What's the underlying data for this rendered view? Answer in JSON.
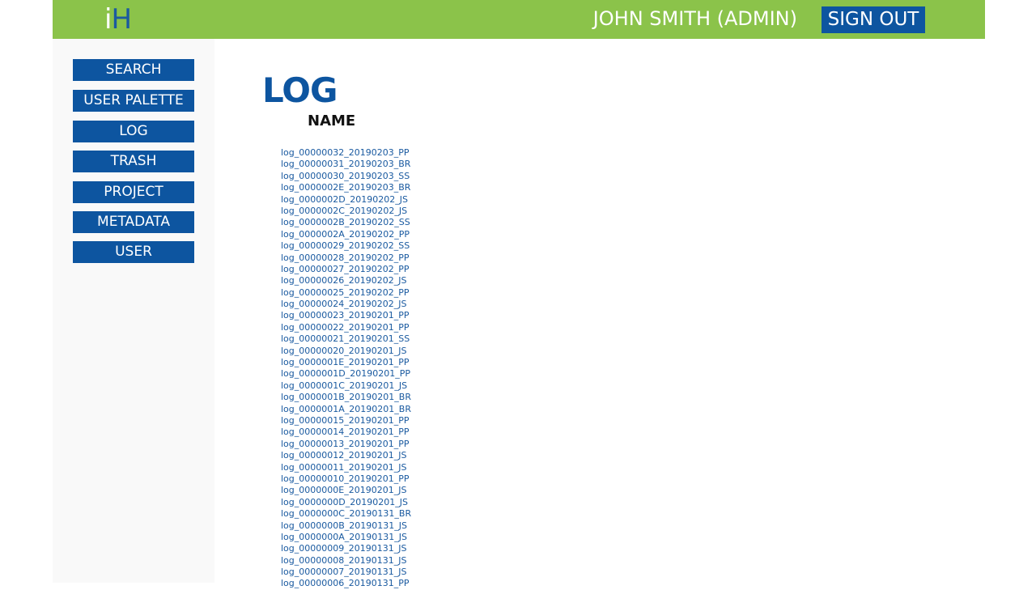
{
  "header": {
    "logo_part1": "i",
    "logo_part2": "H",
    "user_label": "JOHN SMITH (ADMIN)",
    "signout_label": "SIGN OUT"
  },
  "sidebar": {
    "items": [
      {
        "label": "SEARCH"
      },
      {
        "label": "USER PALETTE"
      },
      {
        "label": "LOG"
      },
      {
        "label": "TRASH"
      },
      {
        "label": "PROJECT"
      },
      {
        "label": "METADATA"
      },
      {
        "label": "USER"
      }
    ]
  },
  "main": {
    "title": "LOG",
    "column_header": "NAME",
    "logs": [
      "log_00000032_20190203_PP",
      "log_00000031_20190203_BR",
      "log_00000030_20190203_SS",
      "log_0000002E_20190203_BR",
      "log_0000002D_20190202_JS",
      "log_0000002C_20190202_JS",
      "log_0000002B_20190202_SS",
      "log_0000002A_20190202_PP",
      "log_00000029_20190202_SS",
      "log_00000028_20190202_PP",
      "log_00000027_20190202_PP",
      "log_00000026_20190202_JS",
      "log_00000025_20190202_PP",
      "log_00000024_20190202_JS",
      "log_00000023_20190201_PP",
      "log_00000022_20190201_PP",
      "log_00000021_20190201_SS",
      "log_00000020_20190201_JS",
      "log_0000001E_20190201_PP",
      "log_0000001D_20190201_PP",
      "log_0000001C_20190201_JS",
      "log_0000001B_20190201_BR",
      "log_0000001A_20190201_BR",
      "log_00000015_20190201_PP",
      "log_00000014_20190201_PP",
      "log_00000013_20190201_PP",
      "log_00000012_20190201_JS",
      "log_00000011_20190201_JS",
      "log_00000010_20190201_PP",
      "log_0000000E_20190201_JS",
      "log_0000000D_20190201_JS",
      "log_0000000C_20190131_BR",
      "log_0000000B_20190131_JS",
      "log_0000000A_20190131_JS",
      "log_00000009_20190131_JS",
      "log_00000008_20190131_JS",
      "log_00000007_20190131_JS",
      "log_00000006_20190131_PP"
    ]
  },
  "colors": {
    "topbar": "#8bc34a",
    "accent": "#0d55a0",
    "sidebar_bg": "#f9f9f9"
  }
}
